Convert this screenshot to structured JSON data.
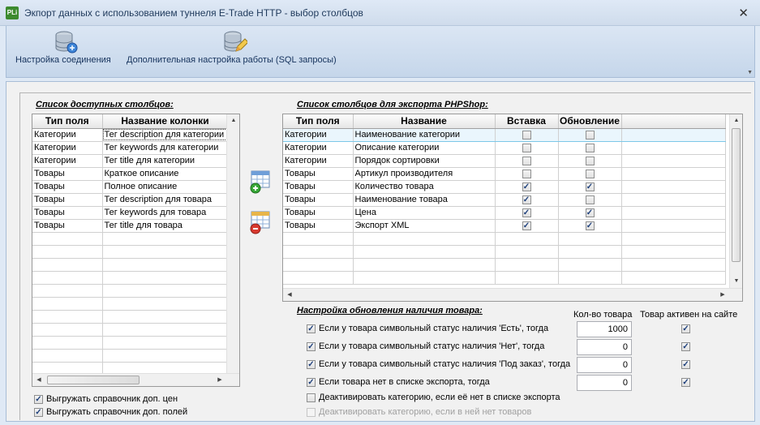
{
  "window": {
    "title": "Экпорт данных с использованием туннеля E-Trade HTTP - выбор столбцов",
    "app_icon_text": "PLi"
  },
  "toolbar": {
    "connection_settings": "Настройка соединения",
    "advanced_settings": "Дополнительная настройка работы (SQL запросы)"
  },
  "available": {
    "title": "Список доступных столбцов:",
    "col_type": "Тип поля",
    "col_name": "Название колонки",
    "rows": [
      {
        "type": "Категории",
        "name": "Тег description для категории"
      },
      {
        "type": "Категории",
        "name": "Тег keywords для категории"
      },
      {
        "type": "Категории",
        "name": "Тег title для категории"
      },
      {
        "type": "Товары",
        "name": "Краткое описание"
      },
      {
        "type": "Товары",
        "name": "Полное описание"
      },
      {
        "type": "Товары",
        "name": "Тег description для товара"
      },
      {
        "type": "Товары",
        "name": "Тег keywords для товара"
      },
      {
        "type": "Товары",
        "name": "Тег title для товара"
      }
    ]
  },
  "export": {
    "title": "Список столбцов для экспорта PHPShop:",
    "col_type": "Тип поля",
    "col_name": "Название",
    "col_insert": "Вставка",
    "col_update": "Обновление",
    "rows": [
      {
        "type": "Категории",
        "name": "Наименование категории",
        "insert": false,
        "update": false
      },
      {
        "type": "Категории",
        "name": "Описание категории",
        "insert": false,
        "update": false
      },
      {
        "type": "Категории",
        "name": "Порядок сортировки",
        "insert": false,
        "update": false
      },
      {
        "type": "Товары",
        "name": "Артикул производителя",
        "insert": false,
        "update": false
      },
      {
        "type": "Товары",
        "name": "Количество товара",
        "insert": true,
        "update": true
      },
      {
        "type": "Товары",
        "name": "Наименование товара",
        "insert": true,
        "update": false
      },
      {
        "type": "Товары",
        "name": "Цена",
        "insert": true,
        "update": true
      },
      {
        "type": "Товары",
        "name": "Экспорт XML",
        "insert": true,
        "update": true
      }
    ]
  },
  "availability": {
    "title": "Настройка обновления наличия товара:",
    "qty_header": "Кол-во товара",
    "active_header": "Товар активен на сайте",
    "rows": [
      {
        "label": "Если у товара символьный статус наличия 'Есть', тогда",
        "checked": true,
        "qty": "1000",
        "active": true
      },
      {
        "label": "Если у товара символьный статус наличия 'Нет', тогда",
        "checked": true,
        "qty": "0",
        "active": true
      },
      {
        "label": "Если у товара символьный статус наличия 'Под заказ', тогда",
        "checked": true,
        "qty": "0",
        "active": true
      },
      {
        "label": "Если товара нет в списке экспорта, тогда",
        "checked": true,
        "qty": "0",
        "active": true
      }
    ],
    "deactivate_missing": {
      "label": "Деактивировать категорию, если её нет в списке экспорта",
      "checked": false
    },
    "deactivate_empty": {
      "label": "Деактивировать категорию, если в ней нет товаров",
      "checked": false
    }
  },
  "bottom_options": {
    "price_ref": {
      "label": "Выгружать справочник доп. цен",
      "checked": true
    },
    "field_ref": {
      "label": "Выгружать справочник доп. полей",
      "checked": true
    }
  }
}
